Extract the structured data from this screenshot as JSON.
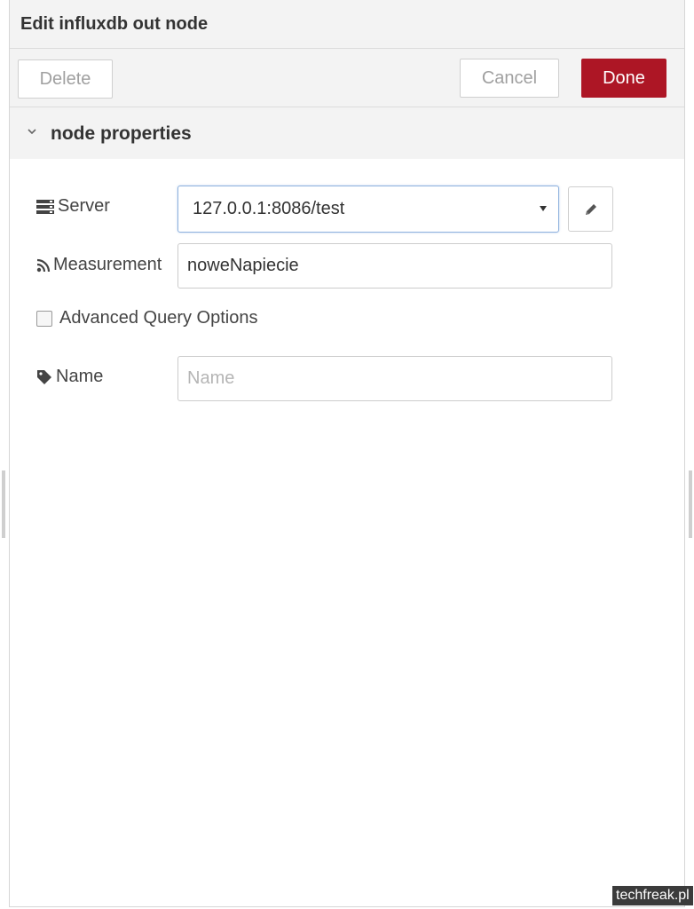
{
  "header": {
    "title": "Edit influxdb out node"
  },
  "toolbar": {
    "delete_label": "Delete",
    "cancel_label": "Cancel",
    "done_label": "Done",
    "done_color": "#ad1625"
  },
  "section": {
    "title": "node properties",
    "expanded": true
  },
  "form": {
    "server": {
      "label": "Server",
      "icon": "server-icon",
      "value": "127.0.0.1:8086/test"
    },
    "measurement": {
      "label": "Measurement",
      "icon": "rss-icon",
      "value": "noweNapiecie"
    },
    "advanced": {
      "label": "Advanced Query Options",
      "checked": false
    },
    "name": {
      "label": "Name",
      "icon": "tag-icon",
      "value": "",
      "placeholder": "Name"
    }
  },
  "watermark": "techfreak.pl"
}
